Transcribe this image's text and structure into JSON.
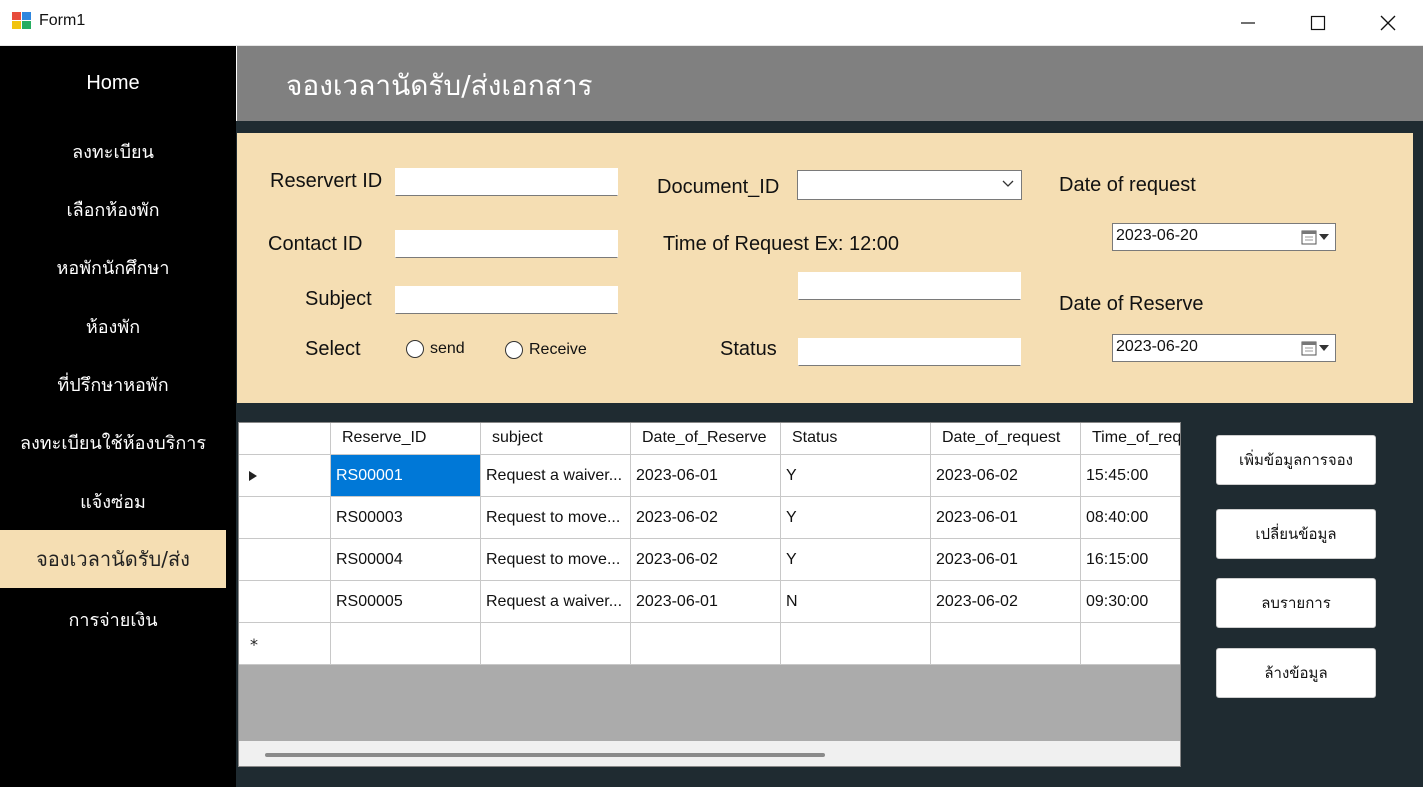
{
  "window": {
    "title": "Form1"
  },
  "sidebar": {
    "items": [
      {
        "label": "Home"
      },
      {
        "label": "ลงทะเบียน"
      },
      {
        "label": "เลือกห้องพัก"
      },
      {
        "label": "หอพักนักศึกษา"
      },
      {
        "label": "ห้องพัก"
      },
      {
        "label": "ที่ปรึกษาหอพัก"
      },
      {
        "label": "ลงทะเบียนใช้ห้องบริการ"
      },
      {
        "label": "แจ้งซ่อม"
      },
      {
        "label": "จองเวลานัดรับ/ส่ง"
      },
      {
        "label": "การจ่ายเงิน"
      }
    ],
    "active_index": 8
  },
  "header": {
    "title": "จองเวลานัดรับ/ส่งเอกสาร"
  },
  "form": {
    "reservert_id_label": "Reservert ID",
    "reservert_id_value": "",
    "contact_id_label": "Contact ID",
    "contact_id_value": "",
    "subject_label": "Subject",
    "subject_value": "",
    "select_label": "Select",
    "radio_send": "send",
    "radio_receive": "Receive",
    "document_id_label": "Document_ID",
    "document_id_value": "",
    "time_of_request_label": "Time of Request  Ex:  12:00",
    "time_value": "",
    "status_label": "Status",
    "status_value": "",
    "date_of_request_label": "Date of request",
    "date_of_request_value": "2023-06-20",
    "date_of_reserve_label": "Date of Reserve",
    "date_of_reserve_value": "2023-06-20"
  },
  "grid": {
    "columns": [
      "Reserve_ID",
      "subject",
      "Date_of_Reserve",
      "Status",
      "Date_of_request",
      "Time_of_req"
    ],
    "rows": [
      [
        "RS00001",
        "Request a waiver...",
        "2023-06-01",
        "Y",
        "2023-06-02",
        "15:45:00"
      ],
      [
        "RS00003",
        "Request to move...",
        "2023-06-02",
        "Y",
        "2023-06-01",
        "08:40:00"
      ],
      [
        "RS00004",
        "Request to move...",
        "2023-06-02",
        "Y",
        "2023-06-01",
        "16:15:00"
      ],
      [
        "RS00005",
        "Request a waiver...",
        "2023-06-01",
        "N",
        "2023-06-02",
        "09:30:00"
      ]
    ],
    "new_row_marker": "*"
  },
  "buttons": {
    "add": "เพิ่มข้อมูลการจอง",
    "edit": "เปลี่ยนข้อมูล",
    "delete": "ลบรายการ",
    "clear": "ล้างข้อมูล"
  },
  "colors": {
    "sidebar_bg": "#000000",
    "active_item_bg": "#f5deb3",
    "header_bg": "#808080",
    "form_bg": "#f5deb3",
    "main_bg": "#1f2b31",
    "selection": "#0078d7"
  }
}
